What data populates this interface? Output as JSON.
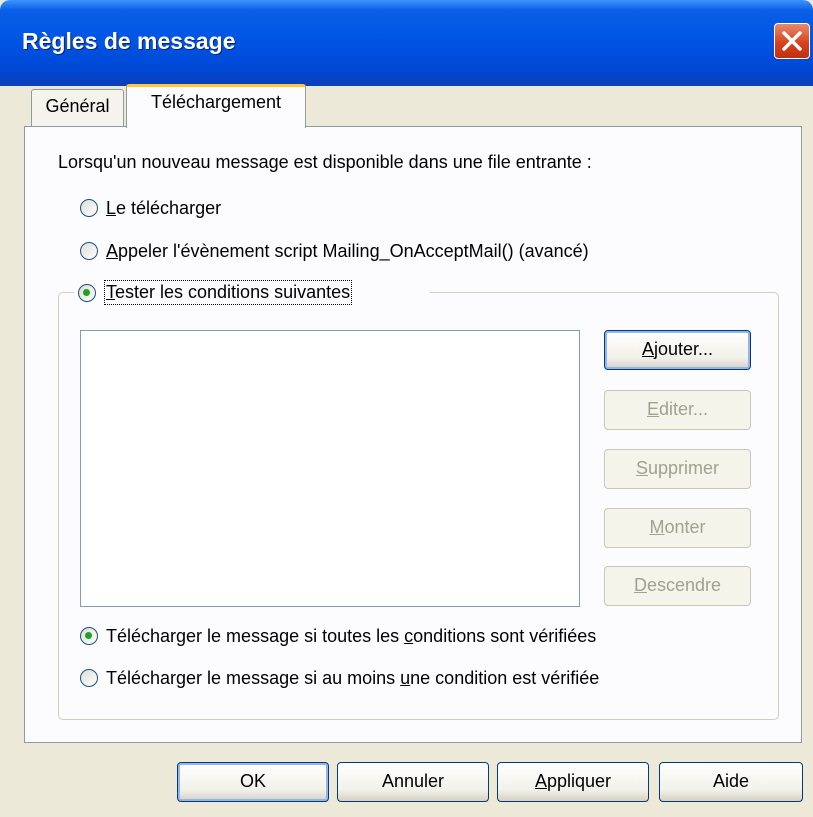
{
  "window": {
    "title": "Règles de message"
  },
  "tabs": [
    {
      "label": "Général"
    },
    {
      "label": "Téléchargement"
    }
  ],
  "panel": {
    "intro": "Lorsqu'un nouveau message est disponible dans une file entrante :",
    "options": [
      {
        "mnemonic": "L",
        "rest": "e télécharger",
        "checked": false
      },
      {
        "mnemonic": "A",
        "rest": "ppeler l'évènement script Mailing_OnAcceptMail() (avancé)",
        "checked": false
      },
      {
        "mnemonic": "T",
        "rest": "ester les conditions suivantes",
        "checked": true
      }
    ],
    "conditions": [],
    "buttons": [
      {
        "mnemonic": "A",
        "rest": "jouter...",
        "enabled": true
      },
      {
        "mnemonic": "E",
        "rest": "diter...",
        "enabled": false
      },
      {
        "mnemonic": "S",
        "rest": "upprimer",
        "enabled": false
      },
      {
        "mnemonic": "M",
        "rest": "onter",
        "enabled": false
      },
      {
        "mnemonic": "D",
        "rest": "escendre",
        "enabled": false
      }
    ],
    "match_all": {
      "pre": "Télécharger le message si toutes les ",
      "mnemonic": "c",
      "post": "onditions sont vérifiées",
      "checked": true
    },
    "match_any": {
      "pre": "Télécharger le message si au moins ",
      "mnemonic": "u",
      "post": "ne condition est vérifiée",
      "checked": false
    }
  },
  "footer": {
    "ok": "OK",
    "cancel": "Annuler",
    "apply_mnemonic": "A",
    "apply_rest": "ppliquer",
    "help": "Aide"
  },
  "colors": {
    "titlebar": "#0055e5",
    "dialog_bg": "#ece9d8",
    "panel_bg": "#fcfcfe",
    "radio_dot": "#21a121",
    "close_button": "#d7431f"
  },
  "icons": {
    "close": "close-icon"
  }
}
